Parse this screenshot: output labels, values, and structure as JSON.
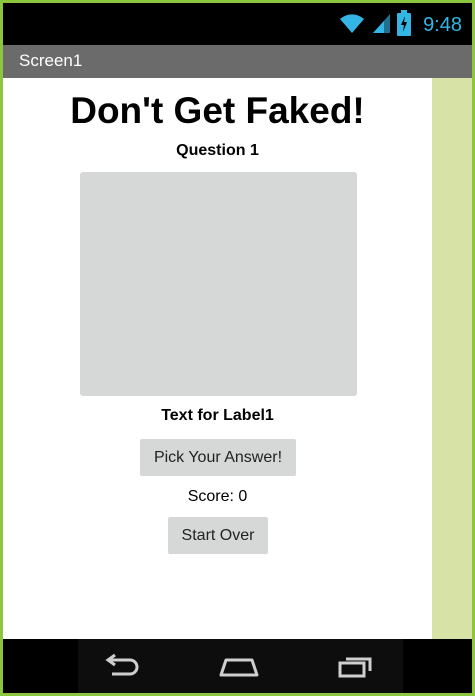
{
  "status_bar": {
    "time": "9:48",
    "icons": [
      "wifi-icon",
      "signal-icon",
      "battery-charging-icon"
    ],
    "accent_color": "#33b5e5"
  },
  "app_bar": {
    "title": "Screen1",
    "color": "#6b6b6b"
  },
  "screen": {
    "heading": "Don't Get Faked!",
    "question_label": "Question 1",
    "image_placeholder_color": "#d6d7d7",
    "label1": "Text for Label1",
    "pick_button_label": "Pick Your Answer!",
    "score_text": "Score: 0",
    "start_over_label": "Start Over"
  },
  "nav_bar": {
    "icons": [
      "back-icon",
      "home-icon",
      "recent-apps-icon"
    ]
  },
  "frame_color": "#8cc63f",
  "side_strip_color": "#d6e2a6"
}
